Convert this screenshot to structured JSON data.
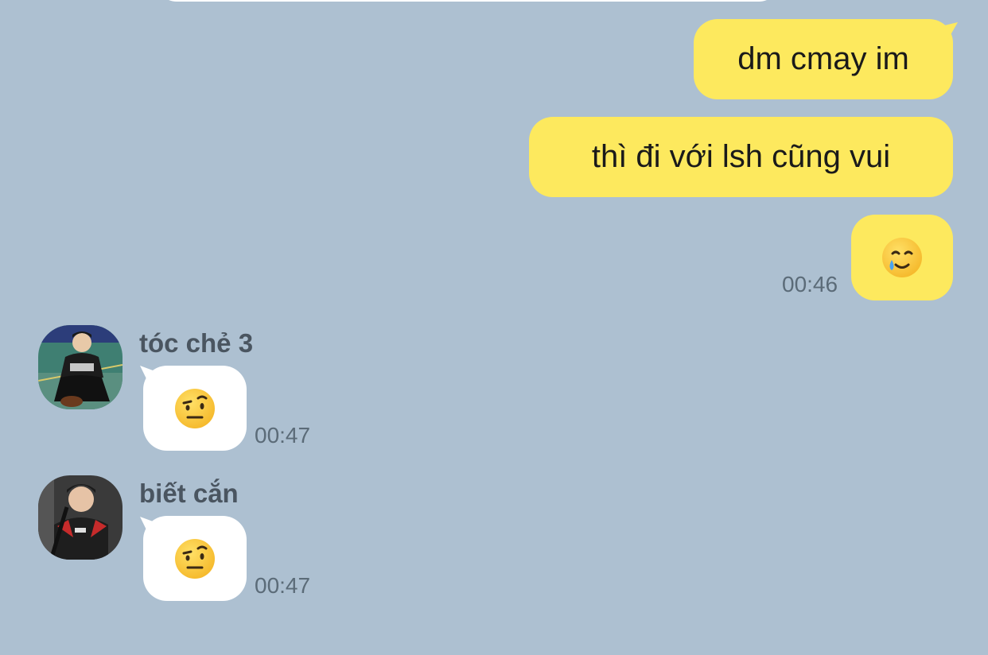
{
  "colors": {
    "background": "#adc0d1",
    "my_bubble": "#fde95e",
    "other_bubble": "#ffffff"
  },
  "messages": {
    "me_1": {
      "text": "dm cmay im"
    },
    "me_2": {
      "text": "thì đi với lsh cũng vui"
    },
    "me_3": {
      "emoji": "smiling-face-with-tear",
      "time": "00:46"
    },
    "other_1": {
      "sender": "tóc chẻ 3",
      "emoji": "face-with-raised-eyebrow",
      "time": "00:47"
    },
    "other_2": {
      "sender": "biết cắn",
      "emoji": "face-with-raised-eyebrow",
      "time": "00:47"
    }
  }
}
